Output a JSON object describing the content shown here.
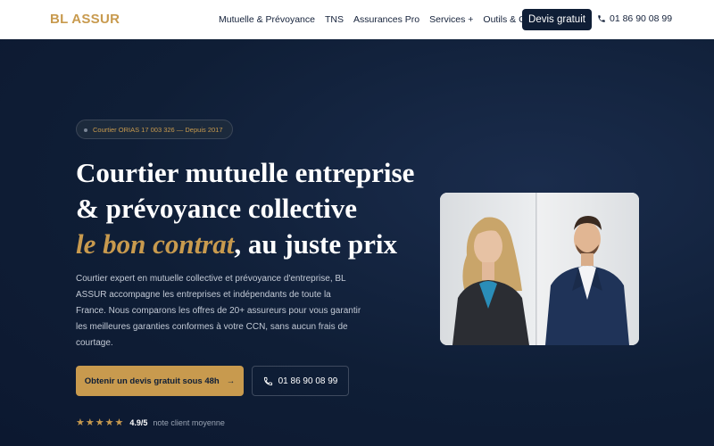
{
  "header": {
    "logo": "BL ASSUR",
    "nav": [
      "Mutuelle & Prévoyance",
      "TNS",
      "Assurances Pro",
      "Services +",
      "Outils & Conseils"
    ],
    "cta_label": "Devis gratuit",
    "phone": "01 86 90 08 99"
  },
  "hero": {
    "badge": "Courtier ORIAS 17 003 326 — Depuis 2017",
    "headline_line1": "Courtier mutuelle entreprise",
    "headline_line2": "& prévoyance collective",
    "headline_highlight": "le bon contrat",
    "headline_rest": ", au juste prix",
    "description": "Courtier expert en mutuelle collective et prévoyance d'entreprise, BL ASSUR accompagne les entreprises et indépendants de toute la France. Nous comparons les offres de 20+ assureurs pour vous garantir les meilleures garanties conformes à votre CCN, sans aucun frais de courtage.",
    "cta_primary": "Obtenir un devis gratuit sous 48h",
    "cta_phone": "01 86 90 08 99",
    "rating_stars": "★★★★★",
    "rating_score": "4.9/5",
    "rating_label": "note client moyenne"
  },
  "colors": {
    "navy": "#0f1e36",
    "gold": "#c89a4e",
    "white": "#ffffff"
  },
  "icons": [
    "phone-icon",
    "arrow-right-icon",
    "star-icon"
  ]
}
